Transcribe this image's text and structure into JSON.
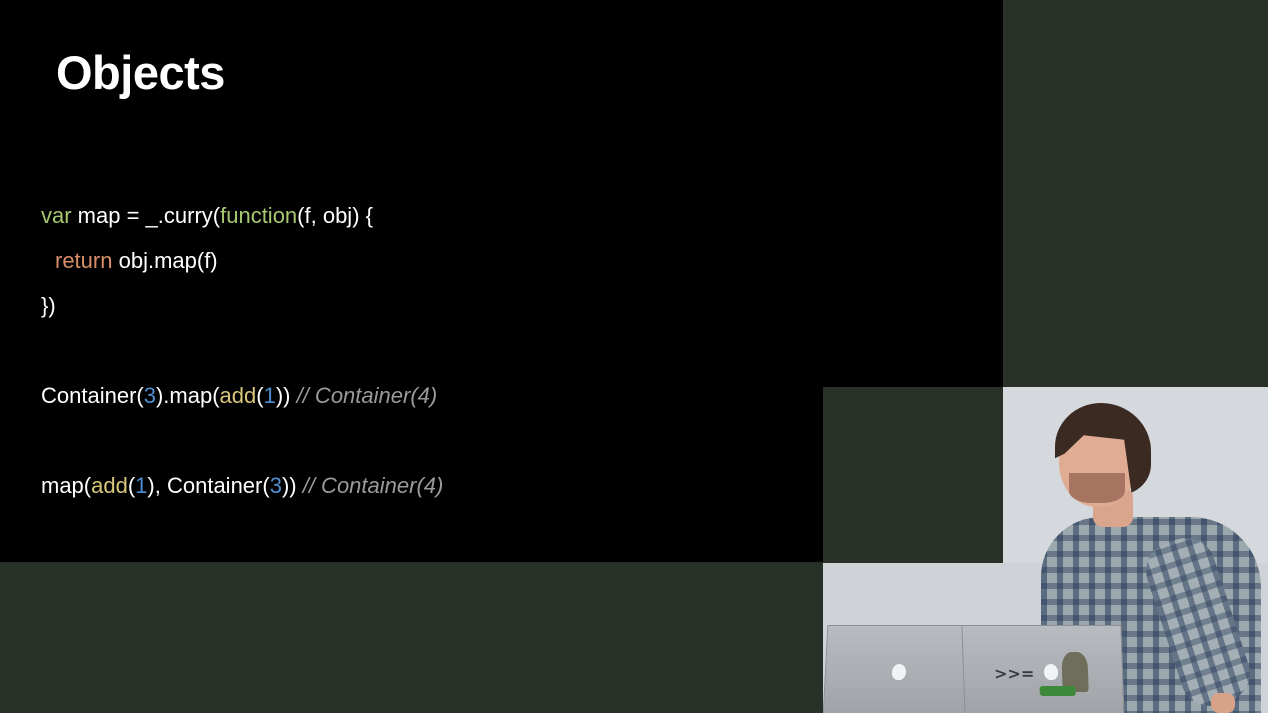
{
  "slide": {
    "title": "Objects",
    "code": {
      "line1": {
        "kw_var": "var",
        "mid": " map = _.curry(",
        "kw_function": "function",
        "end": "(f, obj) {"
      },
      "line2": {
        "kw_return": "return",
        "end": " obj.map(f)"
      },
      "line3": {
        "text": "})"
      },
      "line4": {
        "part1": "Container(",
        "num1": "3",
        "part2": ").map(",
        "fn_add": "add",
        "part3": "(",
        "num2": "1",
        "part4": ")) ",
        "comment": "// Container(4)"
      },
      "line5": {
        "part1": "map(",
        "fn_add": "add",
        "part2": "(",
        "num1": "1",
        "part3": "), Container(",
        "num2": "3",
        "part4": ")) ",
        "comment": "// Container(4)"
      }
    }
  },
  "video": {
    "sticker_text": ">>="
  },
  "colors": {
    "background": "#283128",
    "slide_background": "#000000",
    "keyword_green": "#a6c86f",
    "keyword_orange": "#d98e6a",
    "function_yellow": "#d8c77a",
    "number_blue": "#4f8fd0",
    "comment_gray": "#9a9a9a"
  }
}
